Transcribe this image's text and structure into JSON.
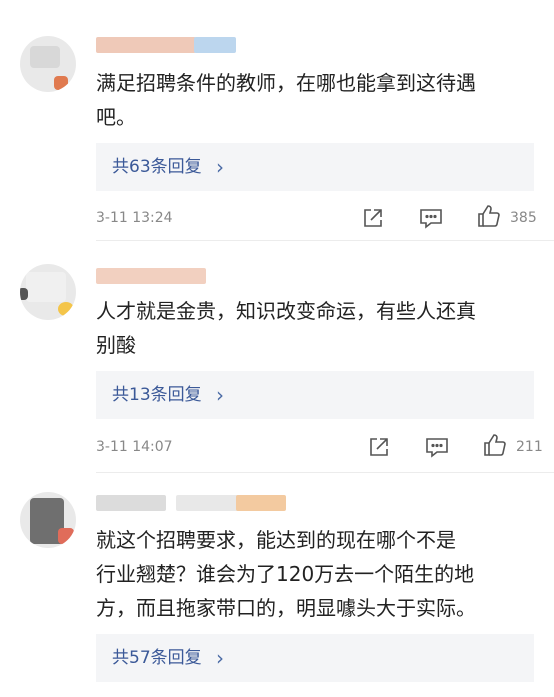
{
  "comments": [
    {
      "text_line1": "满足招聘条件的教师，在哪也能拿到这待遇",
      "text_line2": "吧。",
      "replies_label": "共63条回复",
      "chevron": "›",
      "timestamp": "3-11 13:24",
      "likes": "385"
    },
    {
      "text_line1": "人才就是金贵，知识改变命运，有些人还真",
      "text_line2": "别酸",
      "replies_label": "共13条回复",
      "chevron": "›",
      "timestamp": "3-11 14:07",
      "likes": "211"
    },
    {
      "text_line1": "就这个招聘要求，能达到的现在哪个不是",
      "text_line2": "行业翘楚？谁会为了120万去一个陌生的地",
      "text_line3": "方，而且拖家带口的，明显噱头大于实际。",
      "replies_label": "共57条回复",
      "chevron": "›"
    }
  ],
  "icons": {
    "share": "share-icon",
    "comment": "comment-icon",
    "like": "like-icon"
  },
  "colors": {
    "reply_link": "#3b5998",
    "meta_text": "#888888",
    "reply_box": "#f4f5f7"
  }
}
